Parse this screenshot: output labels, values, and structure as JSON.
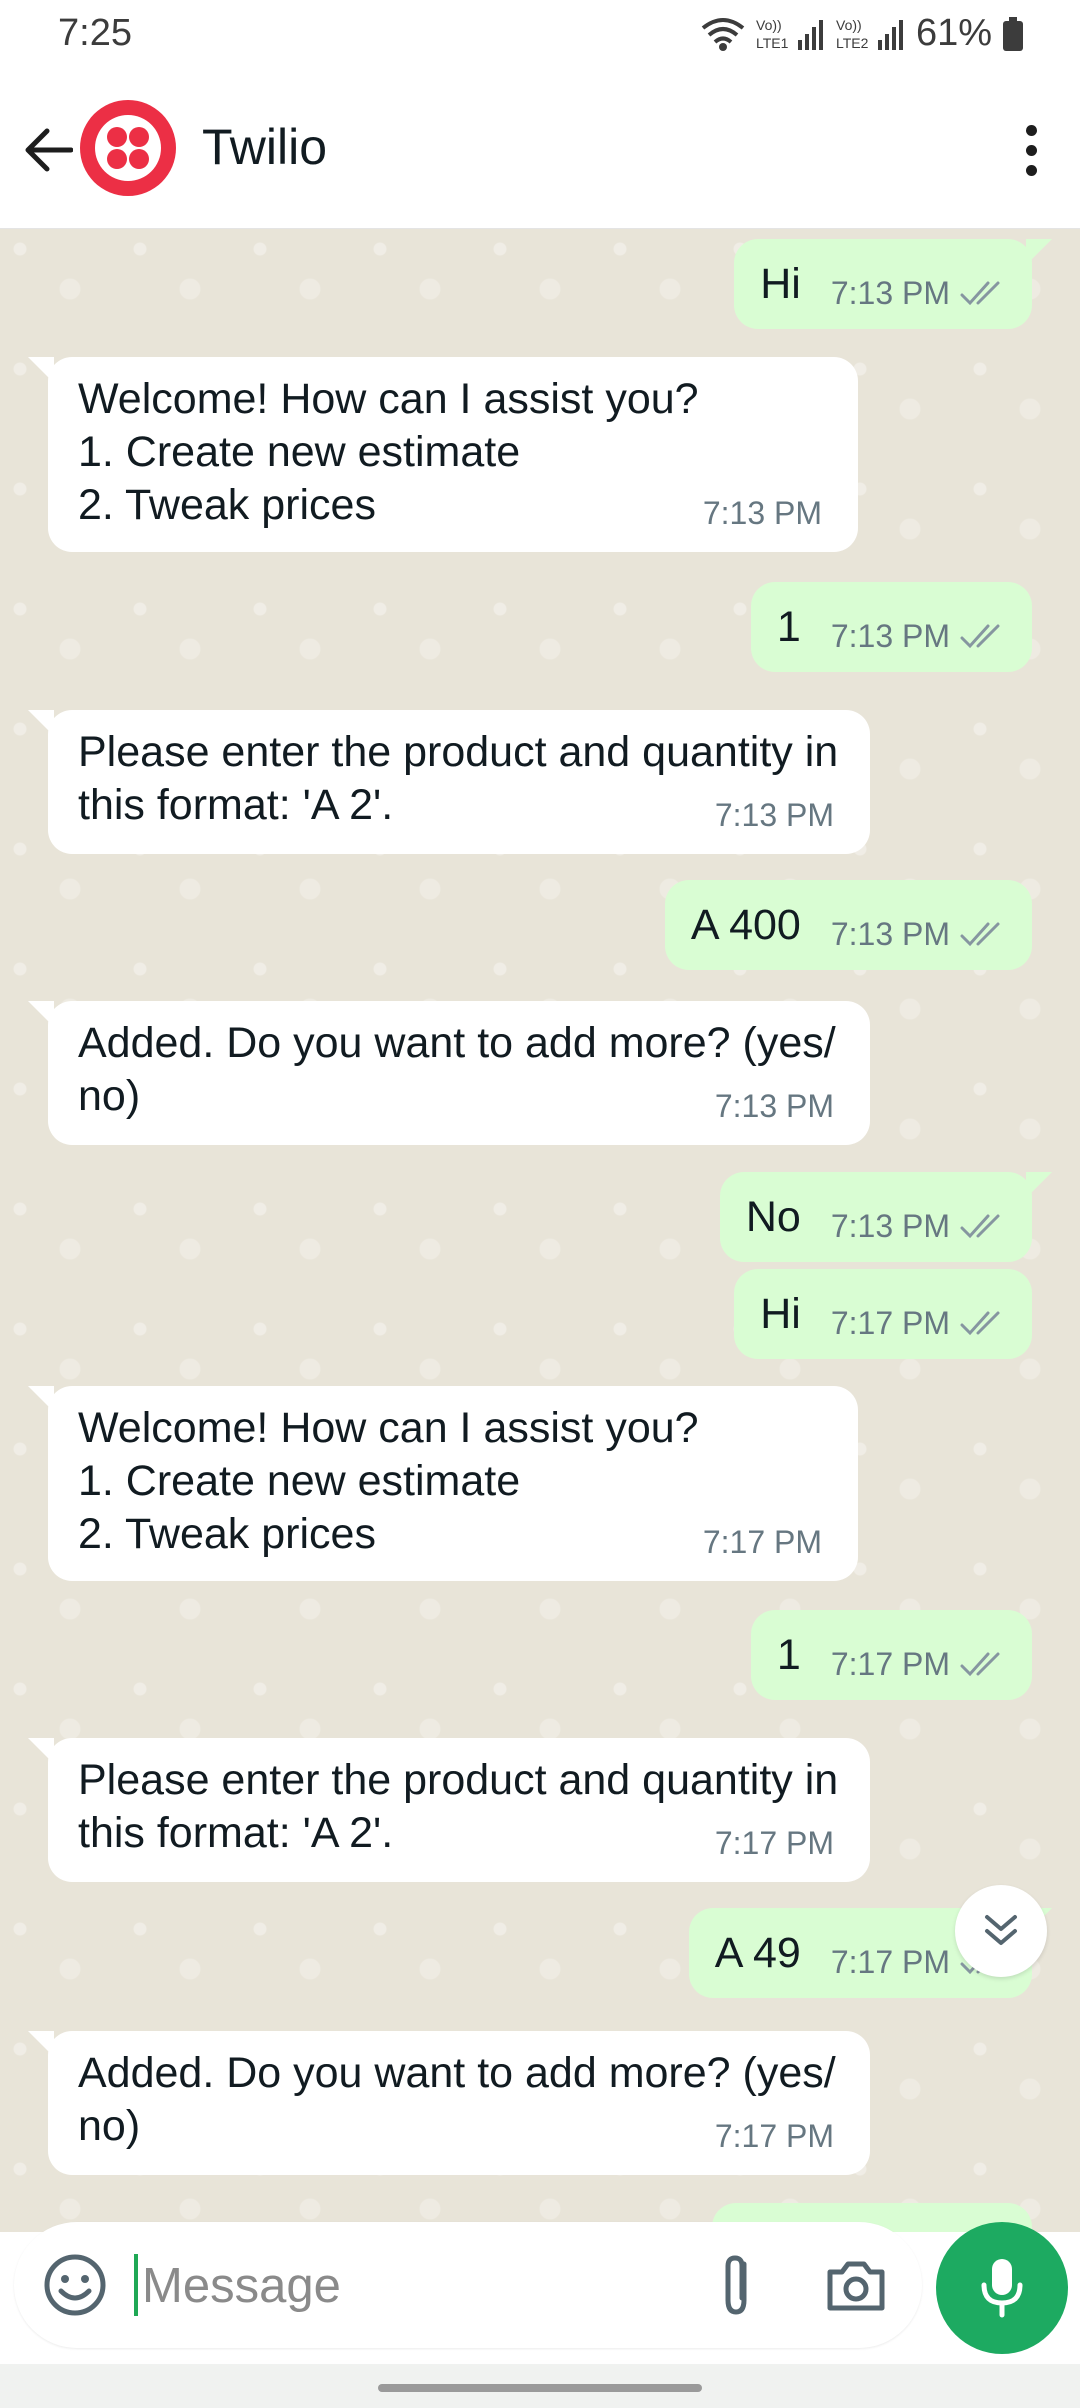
{
  "status_bar": {
    "time": "7:25",
    "battery": "61%",
    "lte1": "Vo)) LTE1",
    "lte2": "Vo)) LTE2"
  },
  "header": {
    "contact_name": "Twilio",
    "avatar_color": "#ec2f45"
  },
  "messages": [
    {
      "dir": "out",
      "text": "Hi",
      "time": "7:13 PM"
    },
    {
      "dir": "in",
      "text": "Welcome! How can I assist you?\n 1. Create new estimate\n 2. Tweak prices",
      "time": "7:13 PM"
    },
    {
      "dir": "out",
      "text": "1",
      "time": "7:13 PM"
    },
    {
      "dir": "in",
      "text": "Please enter the product and quantity in\nthis format: 'A 2'.",
      "time": "7:13 PM"
    },
    {
      "dir": "out",
      "text": "A 400",
      "time": "7:13 PM"
    },
    {
      "dir": "in",
      "text": "Added. Do you want to add more? (yes/\nno)",
      "time": "7:13 PM"
    },
    {
      "dir": "out",
      "text": "No",
      "time": "7:13 PM"
    },
    {
      "dir": "out",
      "text": "Hi",
      "time": "7:17 PM"
    },
    {
      "dir": "in",
      "text": "Welcome! How can I assist you?\n 1. Create new estimate\n 2. Tweak prices",
      "time": "7:17 PM"
    },
    {
      "dir": "out",
      "text": "1",
      "time": "7:17 PM"
    },
    {
      "dir": "in",
      "text": "Please enter the product and quantity in\nthis format: 'A 2'.",
      "time": "7:17 PM"
    },
    {
      "dir": "out",
      "text": "A 49",
      "time": "7:17 PM"
    },
    {
      "dir": "in",
      "text": "Added. Do you want to add more? (yes/\nno)",
      "time": "7:17 PM"
    }
  ],
  "input": {
    "placeholder": "Message"
  },
  "colors": {
    "outgoing_bubble": "#d9fdd3",
    "incoming_bubble": "#ffffff",
    "mic_button": "#1daa61",
    "read_ticks": "#8696a0"
  }
}
